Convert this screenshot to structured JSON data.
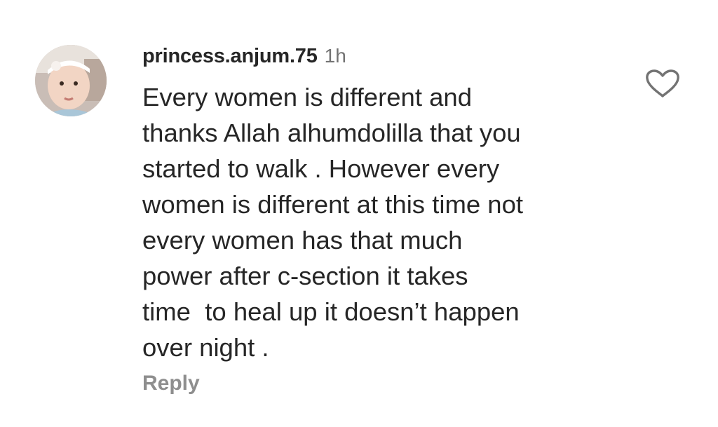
{
  "comment": {
    "username": "princess.anjum.75",
    "timestamp": "1h",
    "text_lines": [
      "Every women is different and",
      "thanks Allah alhumdolilla that you",
      "started to walk . However every",
      "women is different at this time not",
      "every women has that much",
      "power after c-section it takes",
      "time  to heal up it doesn’t happen",
      "over night ."
    ],
    "reply_label": "Reply",
    "avatar_icon": "user-avatar",
    "like_icon": "heart-outline-icon"
  },
  "colors": {
    "text": "#262626",
    "secondary": "#737373",
    "reply": "#8e8e8e",
    "background": "#ffffff"
  }
}
